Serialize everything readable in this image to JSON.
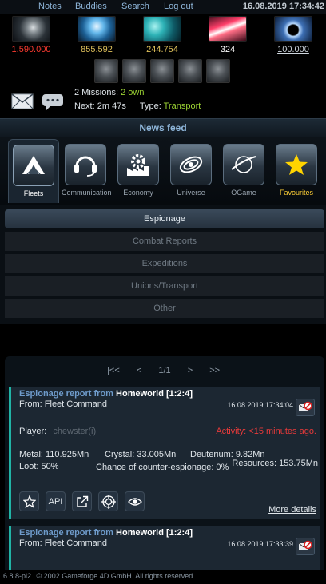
{
  "topbar": {
    "links": [
      "Notes",
      "Buddies",
      "Search",
      "Log out"
    ],
    "datetime": "16.08.2019 17:34:42"
  },
  "resources": {
    "metal": {
      "value": "1.590.000",
      "color": "#ff3b30"
    },
    "crystal": {
      "value": "855.592",
      "color": "#e0c15b"
    },
    "deuterium": {
      "value": "244.754",
      "color": "#e0c15b"
    },
    "energy": {
      "value": "324",
      "color": "#ffffff"
    },
    "dark_matter": {
      "value": "100.000",
      "color": "#cfd6de"
    }
  },
  "missions": {
    "count_text": "2 Missions:",
    "own_text": "2 own",
    "next_label": "Next:",
    "next_time": "2m 47s",
    "type_label": "Type:",
    "type_value": "Transport"
  },
  "news_feed": {
    "title": "News feed"
  },
  "categories": [
    {
      "label": "Fleets",
      "icon": "fleets-icon"
    },
    {
      "label": "Communication",
      "icon": "headset-icon"
    },
    {
      "label": "Economy",
      "icon": "factory-icon"
    },
    {
      "label": "Universe",
      "icon": "galaxy-icon"
    },
    {
      "label": "OGame",
      "icon": "planet-icon"
    },
    {
      "label": "Favourites",
      "icon": "star-icon"
    }
  ],
  "subtabs": [
    "Espionage",
    "Combat Reports",
    "Expeditions",
    "Unions/Transport",
    "Other"
  ],
  "pager": {
    "first": "|<<",
    "prev": "<",
    "page": "1/1",
    "next": ">",
    "last": ">>|"
  },
  "messages": [
    {
      "title_prefix": "Espionage report from",
      "title_planet": "Homeworld [1:2:4]",
      "from": "From: Fleet Command",
      "date": "16.08.2019 17:34:04",
      "player_label": "Player:",
      "player_name": "chewster",
      "player_suffix": "(i)",
      "activity": "Activity: <15 minutes ago.",
      "metal": "Metal: 110.925Mn",
      "crystal": "Crystal: 33.005Mn",
      "deuterium": "Deuterium: 9.82Mn",
      "loot": "Loot: 50%",
      "counter": "Chance of counter-espionage: 0%",
      "resources": "Resources: 153.75Mn",
      "actions": {
        "api": "API"
      },
      "more": "More details"
    },
    {
      "title_prefix": "Espionage report from",
      "title_planet": "Homeworld [1:2:4]",
      "from": "From: Fleet Command",
      "date": "16.08.2019 17:33:39"
    }
  ],
  "footer": {
    "version": "6.8.8-pl2",
    "copyright": "© 2002 Gameforge 4D GmbH. All rights reserved."
  }
}
